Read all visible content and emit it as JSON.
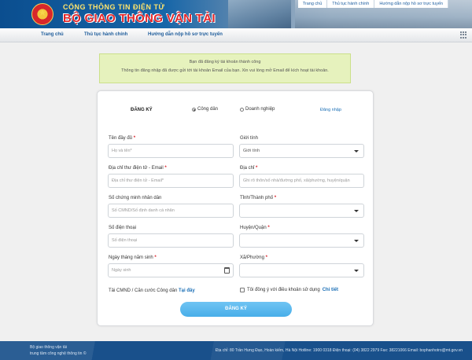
{
  "header": {
    "subtitle": "CỔNG THÔNG TIN ĐIỆN TỬ",
    "title": "BỘ GIAO THÔNG VẬN TẢI",
    "top_links": [
      "Trang chủ",
      "Thủ tục hành chính",
      "Hướng dẫn nộp hồ sơ trực tuyến"
    ]
  },
  "nav": {
    "items": [
      "Trang chủ",
      "Thủ tục hành chính",
      "Hướng dẫn nộp hồ sơ trực tuyến"
    ]
  },
  "notice": {
    "line1": "Bạn đã đăng ký tài khoản thành công",
    "line2": "Thông tin đăng nhập đã được gửi tới tài khoản Email của bạn. Xin vui lòng mở Email để kích hoạt tài khoản."
  },
  "form": {
    "title": "ĐĂNG KÝ",
    "radio_citizen": "Công dân",
    "radio_business": "Doanh nghiệp",
    "login_link": "Đăng nhập",
    "full_name_label": "Tên đầy đủ",
    "full_name_placeholder": "Họ và tên*",
    "gender_label": "Giới tính",
    "gender_value": "Giới tính",
    "email_label": "Địa chỉ thư điện tử - Email",
    "email_placeholder": "Địa chỉ thư điện tử - Email*",
    "address_label": "Địa chỉ",
    "address_placeholder": "Ghi rõ thôn/số nhà/đường phố, xã/phường, huyện/quận",
    "id_label": "Số chứng minh nhân dân",
    "id_placeholder": "Số CMND/Số định danh cá nhân",
    "province_label": "Tỉnh/Thành phố",
    "phone_label": "Số điện thoại",
    "phone_placeholder": "Số điện thoại",
    "district_label": "Huyện/Quận",
    "dob_label": "Ngày tháng năm sinh",
    "dob_placeholder": "Ngày sinh",
    "ward_label": "Xã/Phường",
    "upload_text": "Tải CMND / Căn cước Công dân",
    "upload_link": "Tại đây",
    "agree_text": "Tôi đồng ý với điều khoản sử dụng",
    "agree_link": "Chi tiết",
    "submit": "ĐĂNG KÝ",
    "required_mark": "*"
  },
  "footer": {
    "line1": "Bộ giao thông vận tải",
    "line2": "trung tâm công nghệ thông tin ©",
    "contact": "Địa chỉ: 80 Trần Hưng Đạo, Hoàn kiếm, Hà Nội Hotline: 1900 0318 Điện thoại: (04) 3822 2979 Fax: 38221066 Email: bophanhotro@mt.gov.vn"
  },
  "colors": {
    "header_blue": "#0b4e8f",
    "link_blue": "#1b6fb6",
    "notice_bg": "#e6f2bd",
    "submit_bg": "#48aee9",
    "required_red": "#d9232a",
    "footer_bg": "#19508b"
  },
  "icons": [
    "emblem-icon",
    "grid-menu-icon",
    "chevron-down-icon",
    "calendar-icon"
  ]
}
